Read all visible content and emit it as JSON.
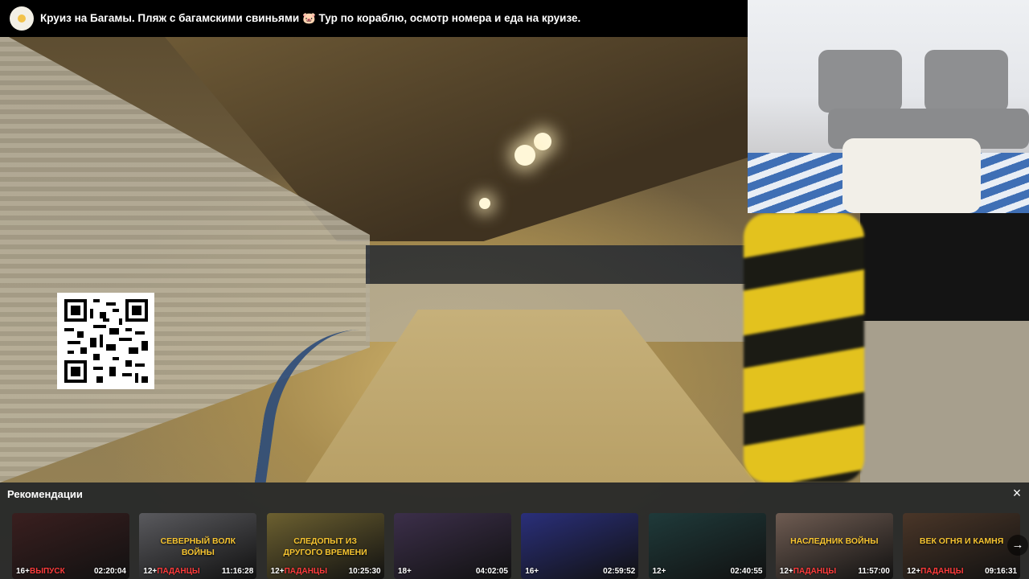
{
  "video": {
    "title": "Круиз на Багамы. Пляж с багамскими свиньями 🐷 Тур по кораблю, осмотр номера и еда на круизе."
  },
  "recommendations": {
    "heading": "Рекомендации",
    "close_icon": "×",
    "next_icon": "→",
    "cards": [
      {
        "caption": "",
        "rating": "16+",
        "badge": "ВЫПУСК",
        "duration": "02:20:04",
        "bg": "#3a1f1f"
      },
      {
        "caption": "СЕВЕРНЫЙ ВОЛК ВОЙНЫ",
        "rating": "12+",
        "badge": "ПАДАНЦЫ",
        "duration": "11:16:28",
        "bg": "#5a5a5e"
      },
      {
        "caption": "СЛЕДОПЫТ ИЗ ДРУГОГО ВРЕМЕНИ",
        "rating": "12+",
        "badge": "ПАДАНЦЫ",
        "duration": "10:25:30",
        "bg": "#6c6030"
      },
      {
        "caption": "",
        "rating": "18+",
        "badge": "",
        "duration": "04:02:05",
        "bg": "#3c2f4a"
      },
      {
        "caption": "",
        "rating": "16+",
        "badge": "",
        "duration": "02:59:52",
        "bg": "#2a2f7a"
      },
      {
        "caption": "",
        "rating": "12+",
        "badge": "",
        "duration": "02:40:55",
        "bg": "#1f3a3a"
      },
      {
        "caption": "НАСЛЕДНИК ВОЙНЫ",
        "rating": "12+",
        "badge": "ПАДАНЦЫ",
        "duration": "11:57:00",
        "bg": "#6f5c52"
      },
      {
        "caption": "ВЕК ОГНЯ И КАМНЯ",
        "rating": "12+",
        "badge": "ПАДАНЦЫ",
        "duration": "09:16:31",
        "bg": "#4a3628"
      }
    ]
  },
  "icons": {
    "avatar": "channel-avatar",
    "qr": "qr-code",
    "close": "close-icon",
    "next": "arrow-right-icon"
  }
}
